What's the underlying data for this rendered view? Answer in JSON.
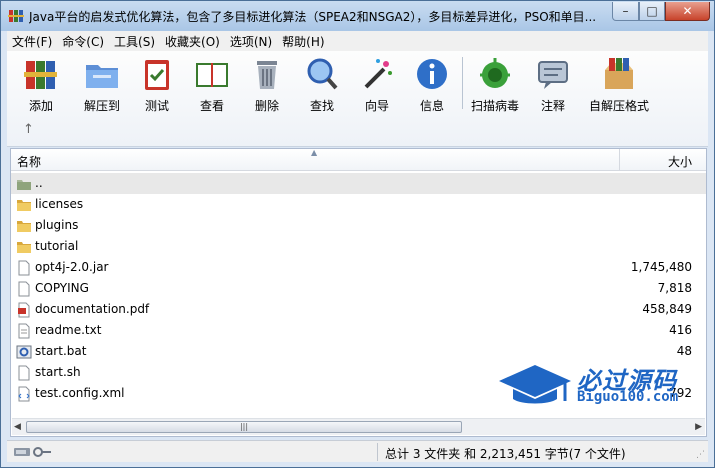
{
  "window": {
    "title": "Java平台的启发式优化算法，包含了多目标进化算法（SPEA2和NSGA2），多目标差异进化，PSO和单目...",
    "controls": {
      "minimize": "–",
      "maximize": "□",
      "close": "✕"
    }
  },
  "menu": [
    "文件(F)",
    "命令(C)",
    "工具(S)",
    "收藏夹(O)",
    "选项(N)",
    "帮助(H)"
  ],
  "toolbar": {
    "buttons": [
      {
        "label": "添加",
        "icon": "books-add-icon"
      },
      {
        "label": "解压到",
        "icon": "folder-extract-icon"
      },
      {
        "label": "测试",
        "icon": "clipboard-check-icon"
      },
      {
        "label": "查看",
        "icon": "open-book-icon"
      },
      {
        "label": "删除",
        "icon": "trash-can-icon"
      },
      {
        "label": "查找",
        "icon": "magnifier-icon"
      },
      {
        "label": "向导",
        "icon": "magic-wand-icon"
      },
      {
        "label": "信息",
        "icon": "info-icon"
      },
      {
        "label": "扫描病毒",
        "icon": "virus-scan-icon"
      },
      {
        "label": "注释",
        "icon": "comment-icon"
      },
      {
        "label": "自解压格式",
        "icon": "sfx-box-icon"
      }
    ],
    "up_label": "↑"
  },
  "list": {
    "headers": {
      "name": "名称",
      "size": "大小"
    },
    "rows": [
      {
        "name": "..",
        "size": "",
        "icon": "parent-folder-icon"
      },
      {
        "name": "licenses",
        "size": "",
        "icon": "folder-icon"
      },
      {
        "name": "plugins",
        "size": "",
        "icon": "folder-icon"
      },
      {
        "name": "tutorial",
        "size": "",
        "icon": "folder-icon"
      },
      {
        "name": "opt4j-2.0.jar",
        "size": "1,745,480",
        "icon": "file-icon"
      },
      {
        "name": "COPYING",
        "size": "7,818",
        "icon": "file-icon"
      },
      {
        "name": "documentation.pdf",
        "size": "458,849",
        "icon": "pdf-icon"
      },
      {
        "name": "readme.txt",
        "size": "416",
        "icon": "text-file-icon"
      },
      {
        "name": "start.bat",
        "size": "48",
        "icon": "batch-file-icon"
      },
      {
        "name": "start.sh",
        "size": "",
        "icon": "file-icon"
      },
      {
        "name": "test.config.xml",
        "size": "792",
        "icon": "xml-file-icon"
      }
    ]
  },
  "status": {
    "text": "总计 3 文件夹 和 2,213,451 字节(7 个文件)"
  },
  "watermark": {
    "title": "必过源码",
    "subtitle": "Biguo100.com"
  },
  "colors": {
    "accent": "#1f66c4",
    "folder": "#e8c35a",
    "close": "#c7432b"
  }
}
